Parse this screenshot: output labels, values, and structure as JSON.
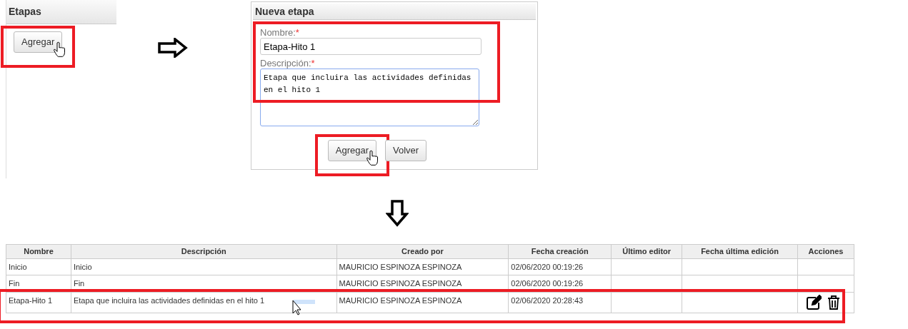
{
  "stages_panel": {
    "title": "Etapas",
    "add_button": {
      "label": "Agregar",
      "highlighted": true,
      "pointer": true
    }
  },
  "new_stage_form": {
    "title": "Nueva etapa",
    "highlighted": true,
    "fields": [
      {
        "label": "Nombre:",
        "required_mark": "*",
        "kind": "input",
        "value": "Etapa-Hito 1"
      },
      {
        "label": "Descripción:",
        "required_mark": "*",
        "kind": "textarea",
        "value": "Etapa que incluira las actividades definidas en el hito 1"
      }
    ],
    "buttons": [
      {
        "label": "Agregar",
        "highlighted": true,
        "pointer": true
      },
      {
        "label": "Volver",
        "highlighted": false,
        "pointer": false
      }
    ]
  },
  "table": {
    "columns": [
      "Nombre",
      "Descripción",
      "Creado por",
      "Fecha creación",
      "Último editor",
      "Fecha última edición",
      "Acciones"
    ],
    "rows": [
      {
        "cells": [
          "Inicio",
          "Inicio",
          "MAURICIO ESPINOZA ESPINOZA",
          "02/06/2020 00:19:26",
          "",
          ""
        ],
        "actions": false,
        "highlighted": false
      },
      {
        "cells": [
          "Fin",
          "Fin",
          "MAURICIO ESPINOZA ESPINOZA",
          "02/06/2020 00:19:26",
          "",
          ""
        ],
        "actions": false,
        "highlighted": false
      },
      {
        "cells": [
          "Etapa-Hito 1",
          "Etapa que incluira las actividades definidas en el hito 1",
          "MAURICIO ESPINOZA ESPINOZA",
          "02/06/2020 20:28:43",
          "",
          ""
        ],
        "actions": true,
        "highlighted": true
      }
    ]
  }
}
